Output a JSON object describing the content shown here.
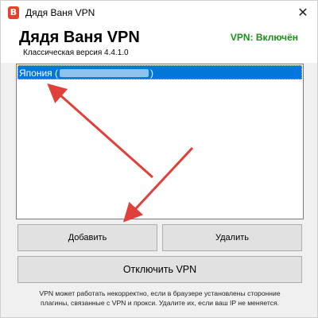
{
  "window": {
    "title": "Дядя Ваня VPN",
    "app_icon_glyph": "В",
    "close_glyph": "✕"
  },
  "header": {
    "app_title": "Дядя Ваня VPN",
    "version": "Классическая версия 4.4.1.0",
    "status": "VPN: Включён"
  },
  "server_list": {
    "items": [
      {
        "prefix": "Япония (",
        "suffix": ")"
      }
    ]
  },
  "buttons": {
    "add": "Добавить",
    "delete": "Удалить",
    "disconnect": "Отключить VPN"
  },
  "footer": {
    "line1": "VPN может работать некорректно, если в браузере установлены сторонние",
    "line2": "плагины, связанные с VPN и прокси. Удалите их, если ваш IP не меняется."
  },
  "colors": {
    "status_green": "#1a8f1a",
    "selection_blue": "#0078d7",
    "arrow_red": "#e0403a",
    "app_icon_red": "#e8412b"
  },
  "icons": [
    "app-icon",
    "close-icon",
    "annotation-arrow"
  ]
}
